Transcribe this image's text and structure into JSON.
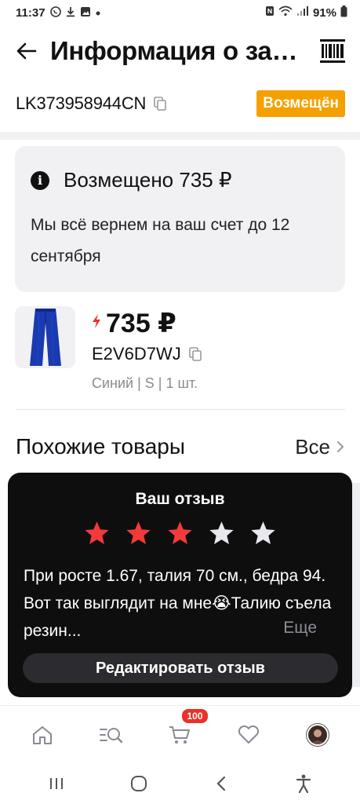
{
  "status_bar": {
    "time": "11:37",
    "battery": "91%",
    "left_icons": [
      "viber-icon",
      "download-icon",
      "image-icon",
      "dot-icon"
    ],
    "right_icons": [
      "nfc-icon",
      "wifi-icon",
      "signal-icon",
      "battery-icon"
    ]
  },
  "header": {
    "title": "Информация о заказе",
    "back_icon": "arrow-left-icon",
    "barcode_icon": "barcode-icon"
  },
  "order": {
    "number": "LK373958944CN",
    "status_badge": "Возмещён",
    "badge_color": "#f5a000"
  },
  "refund": {
    "title": "Возмещено 735 ₽",
    "text": "Мы всё вернем на ваш счет до 12 сентября"
  },
  "product": {
    "price": "735 ₽",
    "sku": "E2V6D7WJ",
    "variant": "Синий | S | 1 шт.",
    "image_color": "#1a3ab0"
  },
  "similar": {
    "title": "Похожие товары",
    "all_label": "Все"
  },
  "review": {
    "title": "Ваш отзыв",
    "rating": 3,
    "max_rating": 5,
    "star_active_color": "#f23a3a",
    "star_inactive_color": "#e8e8ee",
    "text": "При росте 1.67, талия 70 см., бедра 94. Вот так выглядит на мне😭Талию съела резин...",
    "more_label": "Еще",
    "edit_button": "Редактировать отзыв"
  },
  "bottom_nav": {
    "items": [
      "home-icon",
      "catalog-search-icon",
      "cart-icon",
      "favorites-icon",
      "profile-avatar"
    ],
    "cart_count": "100"
  },
  "system_nav": [
    "recents-icon",
    "home-circle-icon",
    "back-chevron-icon",
    "accessibility-icon"
  ]
}
